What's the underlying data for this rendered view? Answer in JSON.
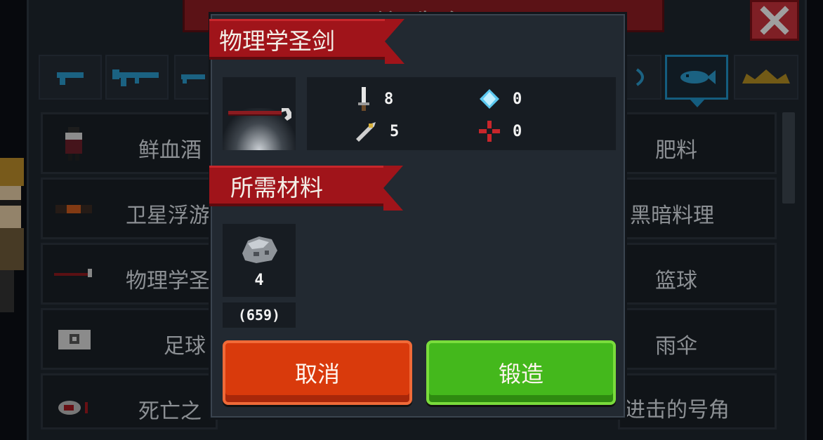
{
  "background": {
    "banner_title": "锻造台",
    "weapon_tabs": [
      "pistol-icon",
      "rifle-icon",
      "shotgun-icon",
      "fish-icon",
      "crown-icon"
    ],
    "left_list": [
      "鲜血酒",
      "卫星浮游",
      "物理学圣",
      "足球",
      "死亡之"
    ],
    "right_list": [
      "肥料",
      "黑暗料理",
      "篮球",
      "雨伞",
      "进击的号角"
    ]
  },
  "modal": {
    "item_name": "物理学圣剑",
    "item_icon": "red-sword-icon",
    "stats": {
      "attack": "8",
      "energy": "0",
      "accuracy": "5",
      "crit": "0"
    },
    "materials_title": "所需材料",
    "material": {
      "icon": "ore-icon",
      "required": "4",
      "owned": "(659)"
    },
    "cancel_label": "取消",
    "forge_label": "锻造"
  },
  "colors": {
    "ribbon": "#a0141a",
    "cancel": "#d93a0c",
    "forge": "#44b81c",
    "tab_active": "#1f8fc4"
  }
}
